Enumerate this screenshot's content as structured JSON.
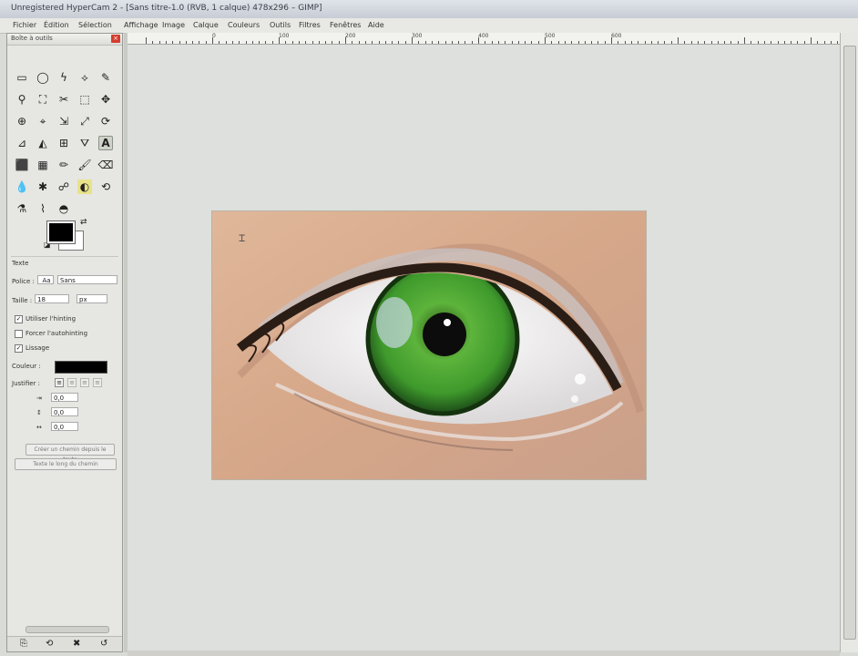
{
  "window": {
    "title": "Unregistered HyperCam 2 - [Sans titre-1.0 (RVB, 1 calque) 478x296 – GIMP]"
  },
  "menubar": {
    "items": [
      "Fichier",
      "Édition",
      "Sélection",
      "Affichage",
      "Image",
      "Calque",
      "Couleurs",
      "Outils",
      "Filtres",
      "Fenêtres",
      "Aide"
    ]
  },
  "toolbox": {
    "title": "Boîte à outils",
    "close_glyph": "×",
    "tools": [
      "▭",
      "◯",
      "ϟ",
      "⟡",
      "✎",
      "⚲",
      "⛶",
      "✂",
      "⬚",
      "✥",
      "⊕",
      "⌖",
      "⇲",
      "⤢",
      "⟳",
      "⊿",
      "◭",
      "⊞",
      "⛛",
      "A",
      "⬛",
      "▦",
      "✏",
      "🖌",
      "⌫",
      "💧",
      "✱",
      "☍",
      "◐",
      "⟲",
      "⚗",
      "⌇",
      "◓",
      "▩",
      "✒"
    ],
    "tool_options": {
      "section_title": "Texte",
      "font_label": "Police :",
      "font_value": "Aa",
      "font_name": "Sans",
      "size_label": "Taille :",
      "size_value": "18",
      "size_unit": "px",
      "hinting_label": "Utiliser l'hinting",
      "autohint_label": "Forcer l'autohinting",
      "antialias_label": "Lissage",
      "color_label": "Couleur :",
      "justify_label": "Justifier :",
      "indent_value": "0,0",
      "line_spacing_value": "0,0",
      "letter_spacing_value": "0,0",
      "create_path_button": "Créer un chemin depuis le texte",
      "path_along_button": "Texte le long du chemin"
    }
  },
  "ruler": {
    "labels": [
      "0",
      "100",
      "200",
      "300",
      "400",
      "500",
      "600"
    ]
  },
  "colors": {
    "accent_close": "#d43d2f",
    "canvas_bg": "#dde0dc",
    "iris_green": "#46a53a",
    "skin": "#d8ab8e"
  }
}
